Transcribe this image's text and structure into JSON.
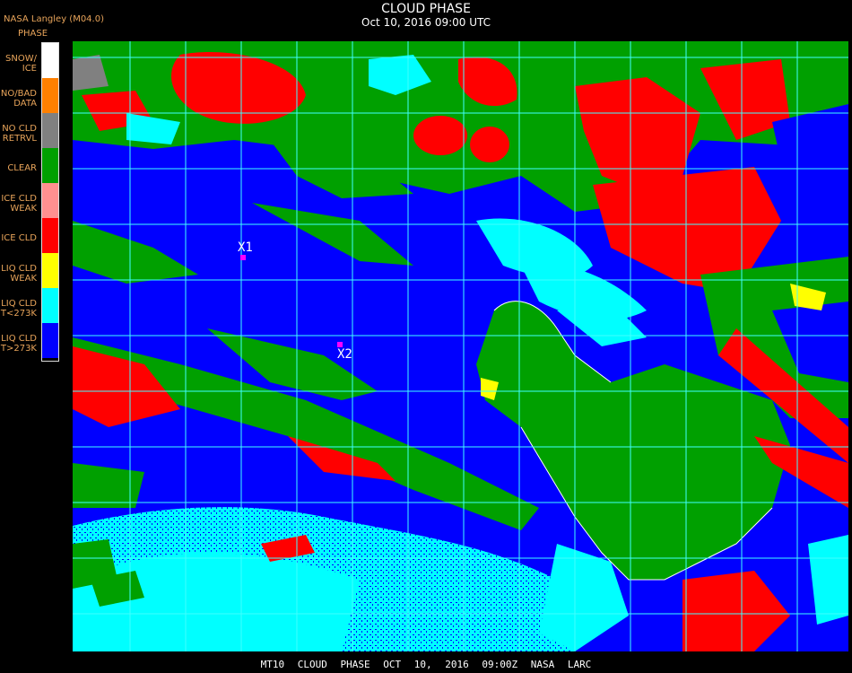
{
  "header": {
    "title": "CLOUD PHASE",
    "datetime": "Oct 10, 2016 09:00 UTC",
    "source": "NASA Langley (M04.0)",
    "legend_title": "PHASE"
  },
  "legend": [
    {
      "label": "SNOW/\nICE",
      "color": "#ffffff"
    },
    {
      "label": "NO/BAD\nDATA",
      "color": "#ff8000"
    },
    {
      "label": "NO CLD\nRETRVL",
      "color": "#808080"
    },
    {
      "label": "CLEAR",
      "color": "#00a000"
    },
    {
      "label": "ICE CLD\nWEAK",
      "color": "#ff9090"
    },
    {
      "label": "ICE CLD",
      "color": "#ff0000"
    },
    {
      "label": "LIQ CLD\nWEAK",
      "color": "#ffff00"
    },
    {
      "label": "LIQ CLD\nT<273K",
      "color": "#00ffff"
    },
    {
      "label": "LIQ CLD\nT>273K",
      "color": "#0000ff"
    }
  ],
  "markers": [
    {
      "label": "X1"
    },
    {
      "label": "X2"
    }
  ],
  "footer": "MT10  CLOUD PHASE  OCT 10, 2016 09:00Z  NASA LARC",
  "colors": {
    "grid": "#40ffff",
    "marker": "#ff00ff",
    "text_accent": "#e8a45a"
  }
}
